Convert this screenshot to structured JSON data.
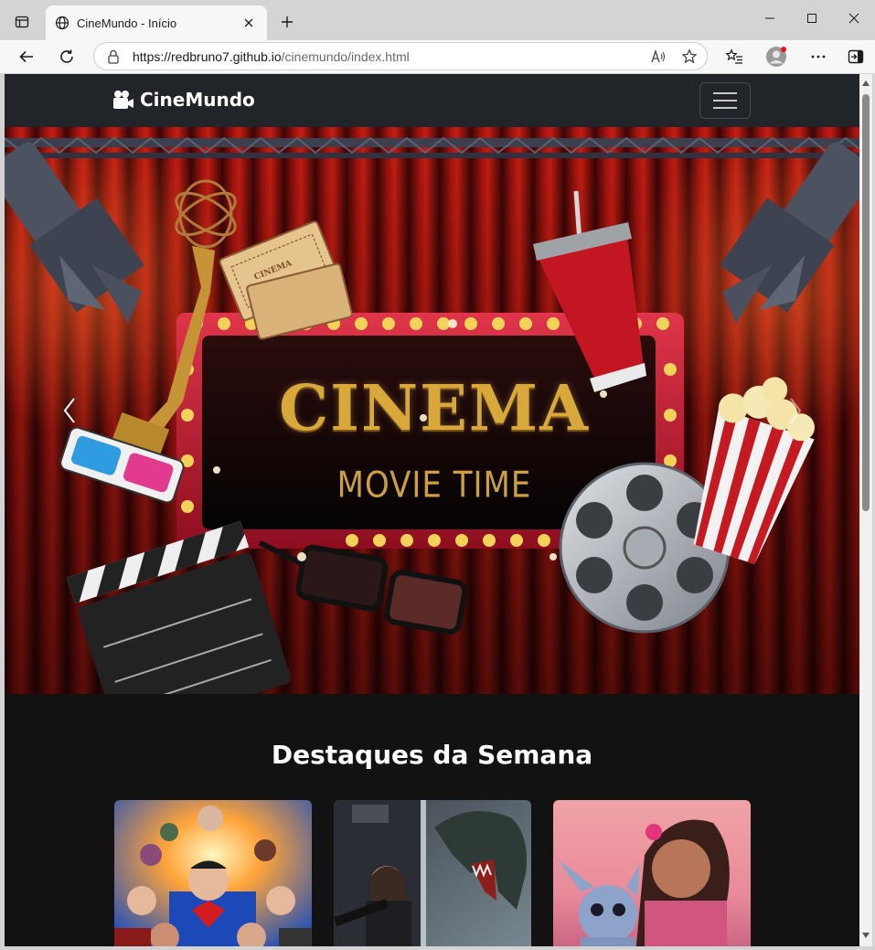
{
  "browser": {
    "tab_title": "CineMundo - Início",
    "url_host": "https://redbruno7.github.io",
    "url_path": "/cinemundo/index.html"
  },
  "navbar": {
    "brand": "CineMundo"
  },
  "hero": {
    "title": "CINEMA",
    "subtitle": "MOVIE TIME",
    "ticket_label": "CINEMA"
  },
  "highlights": {
    "title": "Destaques da Semana",
    "cards": [
      {
        "icon": "superhero-poster"
      },
      {
        "icon": "dinosaur-poster"
      },
      {
        "icon": "alien-girl-poster"
      }
    ]
  }
}
